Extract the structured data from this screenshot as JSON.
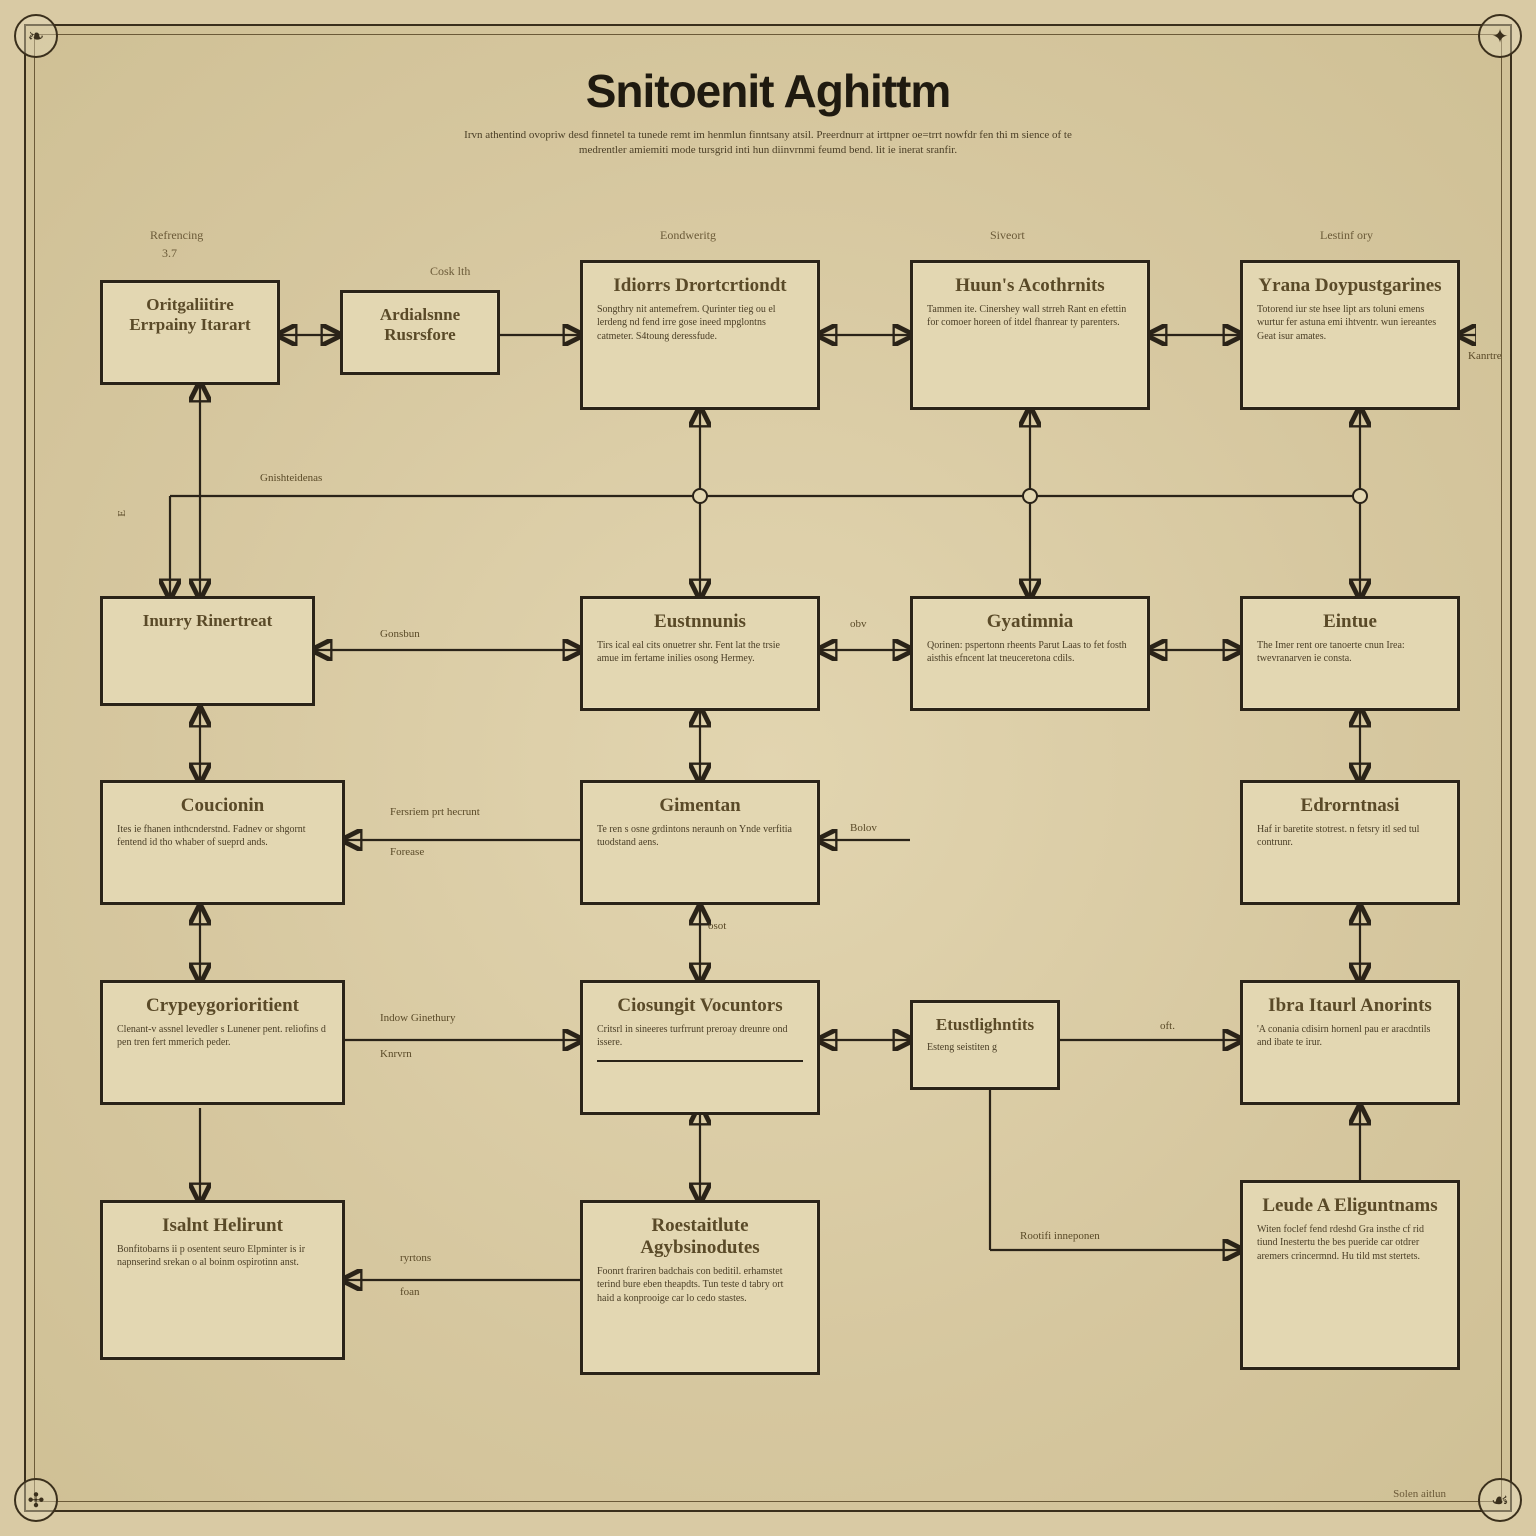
{
  "title": "Snitoenit Aghittm",
  "subtitle": "Irvn athentind ovopriw desd finnetel ta tunede remt im henmlun finntsany atsil. Preerdnurr at irttpner oe=trrt nowfdr fen thi m sience of te medrentler amiemiti mode tursgrid inti hun diinvrnmi feumd bend. lit ie inerat sranfir.",
  "credit": "Solen aitlun",
  "column_labels": {
    "c1": "Refrencing",
    "c2": "Eondweritg",
    "c3": "Siveort",
    "c4": "Lestinf ory"
  },
  "col_sublabels": {
    "c1": "3.7",
    "c2_right": "Cosk lth"
  },
  "boxes": {
    "r1c1": {
      "hd": "Oritgaliitire Errpainy Itarart",
      "bd": ""
    },
    "r1c1b": {
      "hd": "Ardialsnne Rusrsfore",
      "bd": ""
    },
    "r1c2": {
      "hd": "Idiorrs Drortcrtiondt",
      "bd": "Songthry nit antemefrem. Qurinter tieg ou el lerdeng nd fend irre gose ineed mpglontns catmeter. S4toung deressfude."
    },
    "r1c3": {
      "hd": "Huun's Acothrnits",
      "bd": "Tammen ite. Cinershey wall strreh Rant en efettin for comoer horeen of itdel fhanrear ty parenters."
    },
    "r1c4": {
      "hd": "Yrana Doypustgarines",
      "bd": "Totorend iur ste hsee lipt ars toluni emens wurtur fer astuna emi ihtventr. wun iereantes Geat isur amates."
    },
    "r2c1": {
      "hd": "Inurry Rinertreat",
      "bd": ""
    },
    "r2c2": {
      "hd": "Eustnnunis",
      "bd": "Tirs ical eal cits onuetrer shr. Fent lat the trsie amue im fertame inilies osong Hermey."
    },
    "r2c3": {
      "hd": "Gyatimnia",
      "bd": "Qorinen: pspertonn rheents Parut Laas to fet fosth aisthis efncent lat tneuceretona cdils."
    },
    "r2c4": {
      "hd": "Eintue",
      "bd": "The Imer rent ore tanoerte cnun Irea: twevranarven ie consta."
    },
    "r3c1": {
      "hd": "Coucionin",
      "bd": "Ites ie fhanen inthcnderstnd. Fadnev or shgornt fentend id tho whaber of sueprd ands."
    },
    "r3c2": {
      "hd": "Gimentan",
      "bd": "Te ren s osne grdintons neraunh on Ynde verfitia tuodstand aens."
    },
    "r3c4": {
      "hd": "Edrorntnasi",
      "bd": "Haf ir baretite stotrest. n fetsry itl sed tul contrunr."
    },
    "r4c1": {
      "hd": "Crypeygorioritient",
      "bd": "Clenant-v assnel levedler s Lunener pent. reliofins d pen tren fert mmerich peder."
    },
    "r4c2": {
      "hd": "Ciosungit Vocuntors",
      "bd": "Critsrl in sineeres turfrrunt preroay dreunre ond issere."
    },
    "r4c3": {
      "hd": "Etustlighntits",
      "bd": "Esteng seistiten g"
    },
    "r4c4": {
      "hd": "Ibra Itaurl Anorints",
      "bd": "'A conania cdisirn hornenl pau er aracdntils and ibate te irur."
    },
    "r5c1": {
      "hd": "Isalnt Helirunt",
      "bd": "Bonfitobarns ii p osentent seuro Elpminter is ir napnserind srekan o al boinm ospirotinn anst."
    },
    "r5c2": {
      "hd": "Roestaitlute Agybsinodutes",
      "bd": "Foonrt frariren badchais con beditil. erhamstet terind bure eben theapdts. Tun teste d tabry ort haid a konprooige car lo cedo stastes."
    },
    "r5c4": {
      "hd": "Leude A Eliguntnams",
      "bd": "Witen foclef fend rdeshd Gra insthe cf rid tiund Inestertu the bes pueride car otdrer aremers crincermnd. Hu tild mst stertets."
    }
  },
  "edge_labels": {
    "l_r1c1_r1c2": "",
    "l_gushtches": "Gnishteidenas",
    "l_consbun": "Gonsbun",
    "l_r3_left": "Fersriem prt hecrunt",
    "l_r3_left2": "Forease",
    "l_hulow": "Indow Ginethury",
    "l_knrvn": "Knrvrn",
    "l_obv": "obv",
    "l_osot": "osot",
    "l_bolov": "Bolov",
    "l_oft": "oft.",
    "l_ryrtons": "ryrtons",
    "l_foan": "foan",
    "l_root_inner": "Rootifi inneponen",
    "l_kante": "Kanrtre",
    "l_e_right": "E"
  }
}
